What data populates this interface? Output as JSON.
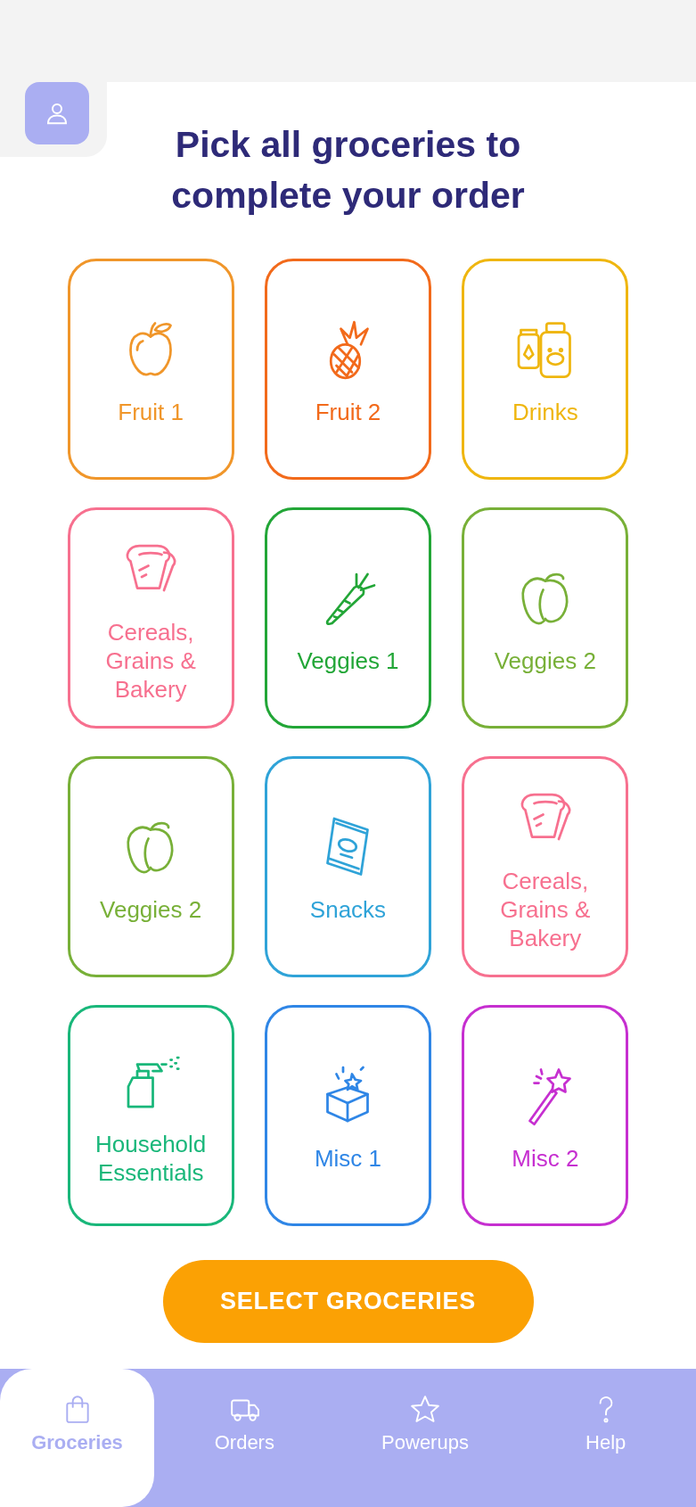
{
  "title": "Pick all groceries to complete your order",
  "tiles": [
    {
      "label": "Fruit 1",
      "kind": "apple",
      "color": "#f0962a"
    },
    {
      "label": "Fruit 2",
      "kind": "pineapple",
      "color": "#f26a1b"
    },
    {
      "label": "Drinks",
      "kind": "drinks",
      "color": "#efb60f"
    },
    {
      "label": "Cereals, Grains & Bakery",
      "kind": "bread",
      "color": "#f7708f"
    },
    {
      "label": "Veggies 1",
      "kind": "carrot",
      "color": "#22a637"
    },
    {
      "label": "Veggies 2",
      "kind": "pepper",
      "color": "#78b038"
    },
    {
      "label": "Veggies 2",
      "kind": "pepper",
      "color": "#78b038"
    },
    {
      "label": "Snacks",
      "kind": "chips",
      "color": "#2fa3d8"
    },
    {
      "label": "Cereals, Grains & Bakery",
      "kind": "bread",
      "color": "#f7708f"
    },
    {
      "label": "Household Essentials",
      "kind": "spray",
      "color": "#19b77a"
    },
    {
      "label": "Misc 1",
      "kind": "box",
      "color": "#2f86e6"
    },
    {
      "label": "Misc 2",
      "kind": "wand",
      "color": "#c62fd0"
    }
  ],
  "button": "SELECT GROCERIES",
  "nav": [
    {
      "label": "Groceries",
      "kind": "bag",
      "selected": true
    },
    {
      "label": "Orders",
      "kind": "truck",
      "selected": false
    },
    {
      "label": "Powerups",
      "kind": "star",
      "selected": false
    },
    {
      "label": "Help",
      "kind": "help",
      "selected": false
    }
  ]
}
